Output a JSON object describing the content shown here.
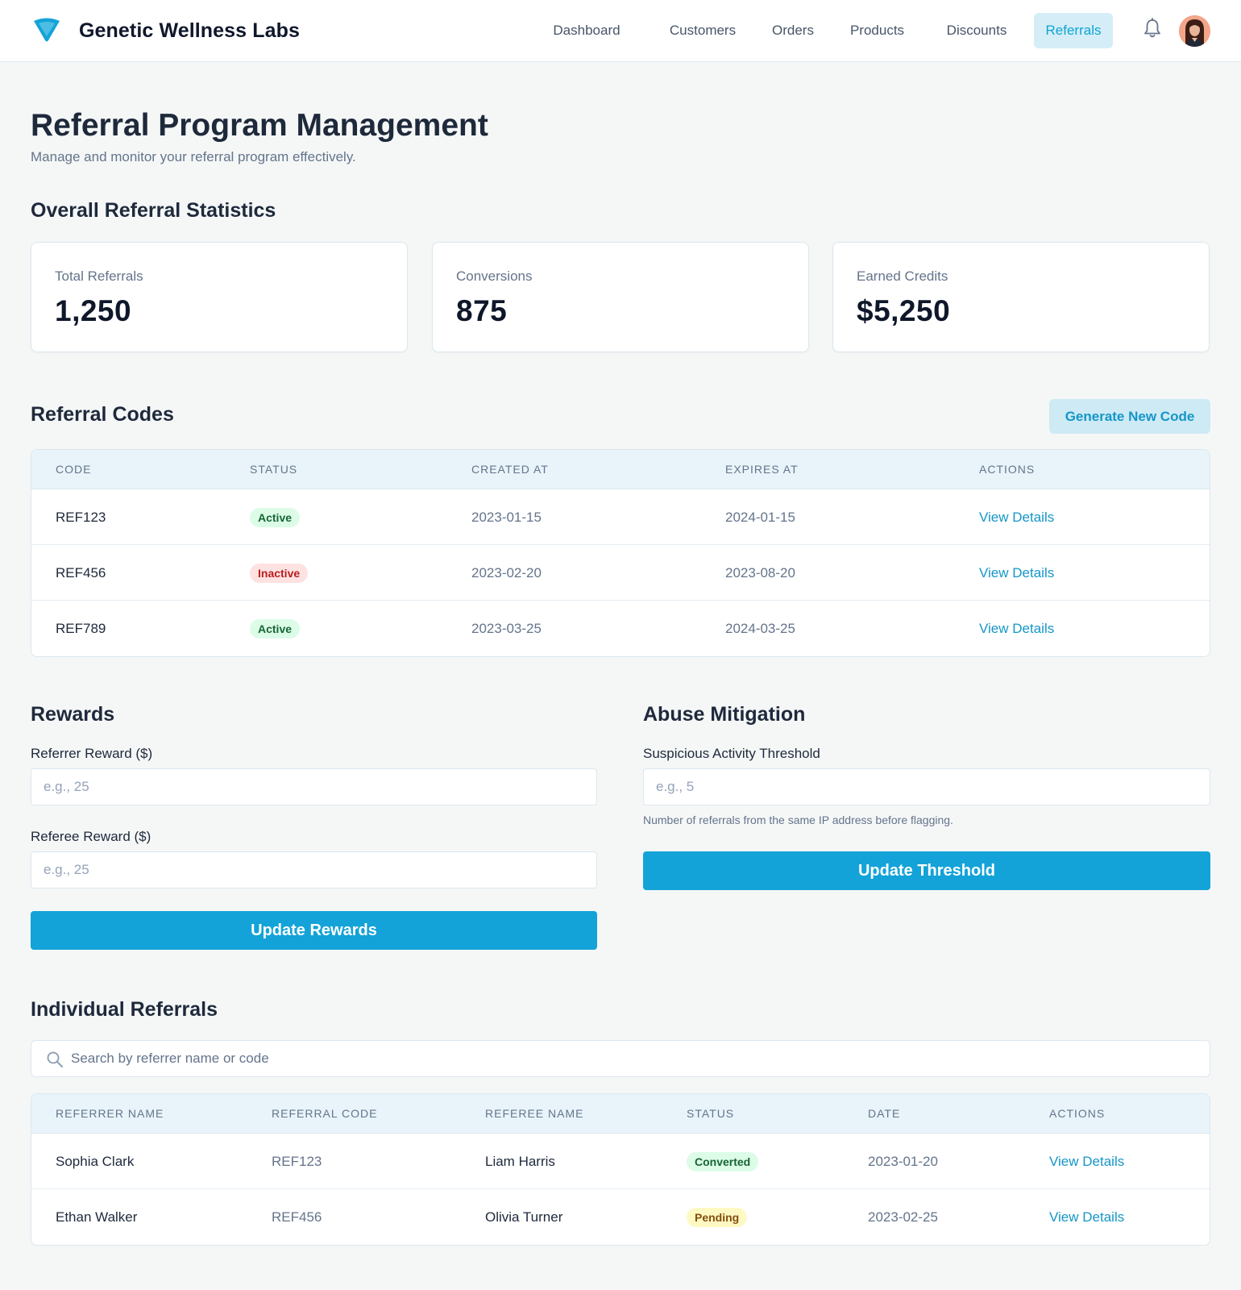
{
  "app": {
    "name": "Genetic Wellness Labs",
    "logo_icon": "funnel-logo-icon",
    "accent_color": "#13a3d8"
  },
  "nav": {
    "items": [
      {
        "label": "Dashboard",
        "active": false
      },
      {
        "label": "Customers",
        "active": false
      },
      {
        "label": "Orders",
        "active": false
      },
      {
        "label": "Products",
        "active": false
      },
      {
        "label": "Discounts",
        "active": false
      },
      {
        "label": "Referrals",
        "active": true
      }
    ],
    "bell_icon": "bell-icon",
    "avatar_icon": "user-avatar"
  },
  "page": {
    "title": "Referral Program Management",
    "subtitle": "Manage and monitor your referral program effectively."
  },
  "stats": {
    "title": "Overall Referral Statistics",
    "cards": [
      {
        "label": "Total Referrals",
        "value": "1,250"
      },
      {
        "label": "Conversions",
        "value": "875"
      },
      {
        "label": "Earned Credits",
        "value": "$5,250"
      }
    ]
  },
  "codes": {
    "title": "Referral Codes",
    "generate_button": "Generate New Code",
    "columns": [
      "Code",
      "Status",
      "Created At",
      "Expires At",
      "Actions"
    ],
    "rows": [
      {
        "code": "REF123",
        "status": "Active",
        "status_color": "green",
        "created": "2023-01-15",
        "expires": "2024-01-15",
        "action": "View Details"
      },
      {
        "code": "REF456",
        "status": "Inactive",
        "status_color": "red",
        "created": "2023-02-20",
        "expires": "2023-08-20",
        "action": "View Details"
      },
      {
        "code": "REF789",
        "status": "Active",
        "status_color": "green",
        "created": "2023-03-25",
        "expires": "2024-03-25",
        "action": "View Details"
      }
    ]
  },
  "rewards": {
    "title": "Rewards",
    "referrer_label": "Referrer Reward ($)",
    "referrer_placeholder": "e.g., 25",
    "referrer_value": "",
    "referee_label": "Referee Reward ($)",
    "referee_placeholder": "e.g., 25",
    "referee_value": "",
    "button": "Update Rewards"
  },
  "abuse": {
    "title": "Abuse Mitigation",
    "threshold_label": "Suspicious Activity Threshold",
    "threshold_placeholder": "e.g., 5",
    "threshold_value": "",
    "help": "Number of referrals from the same IP address before flagging.",
    "button": "Update Threshold"
  },
  "individual": {
    "title": "Individual Referrals",
    "search_placeholder": "Search by referrer name or code",
    "search_value": "",
    "search_icon": "search-icon",
    "columns": [
      "Referrer Name",
      "Referral Code",
      "Referee Name",
      "Status",
      "Date",
      "Actions"
    ],
    "rows": [
      {
        "referrer": "Sophia Clark",
        "code": "REF123",
        "referee": "Liam Harris",
        "status": "Converted",
        "status_color": "green",
        "date": "2023-01-20",
        "action": "View Details"
      },
      {
        "referrer": "Ethan Walker",
        "code": "REF456",
        "referee": "Olivia Turner",
        "status": "Pending",
        "status_color": "yellow",
        "date": "2023-02-25",
        "action": "View Details"
      }
    ]
  }
}
